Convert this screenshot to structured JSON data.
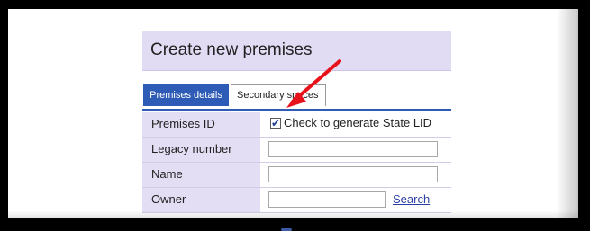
{
  "page": {
    "title": "Create new premises"
  },
  "tabs": [
    {
      "label": "Premises details",
      "active": true
    },
    {
      "label": "Secondary spaces",
      "active": false
    }
  ],
  "form": {
    "rows": [
      {
        "label": "Premises ID",
        "checkbox_label": "Check to generate State LID",
        "checked": true
      },
      {
        "label": "Legacy number",
        "value": ""
      },
      {
        "label": "Name",
        "value": ""
      },
      {
        "label": "Owner",
        "value": "",
        "link": "Search"
      }
    ]
  },
  "colors": {
    "title_bar": "#e1dcf3",
    "label_cell": "#e3def4",
    "active_tab": "#2d5bb5",
    "link": "#2c3fa8",
    "annotation_arrow": "#e8121c"
  },
  "icons": {
    "annotation": "red-arrow-icon",
    "checkbox": "checkmark-icon"
  }
}
